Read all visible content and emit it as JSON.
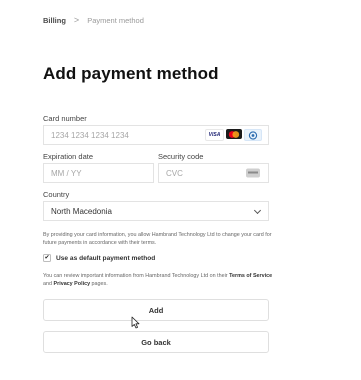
{
  "breadcrumb": {
    "parent": "Billing",
    "separator": ">",
    "current": "Payment method"
  },
  "title": "Add payment method",
  "card_number": {
    "label": "Card number",
    "placeholder": "1234 1234 1234 1234",
    "brands": [
      "visa-icon",
      "mastercard-icon",
      "amex-icon"
    ],
    "visa_text": "VISA"
  },
  "expiration": {
    "label": "Expiration date",
    "placeholder": "MM / YY"
  },
  "security": {
    "label": "Security code",
    "placeholder": "CVC"
  },
  "country": {
    "label": "Country",
    "value": "North Macedonia"
  },
  "consent_text": "By providing your card information, you allow Hambrand Technology Ltd to change your card for future payments in accordance with their terms.",
  "default_checkbox": {
    "label": "Use as default payment method",
    "checked": true,
    "check_glyph": "✔"
  },
  "terms": {
    "prefix": "You can review important information from Hambrand Technology Ltd on their ",
    "tos": "Terms of Service",
    "and": " and ",
    "privacy": "Privacy Policy",
    "suffix": " pages."
  },
  "buttons": {
    "add": "Add",
    "back": "Go back"
  },
  "colors": {
    "border": "#e3e3e3",
    "text": "#1a1a1a",
    "muted": "#9a9a9a",
    "mastercard_red": "#eb001b",
    "mastercard_orange": "#f79e1b",
    "visa_blue": "#1a1f71"
  }
}
